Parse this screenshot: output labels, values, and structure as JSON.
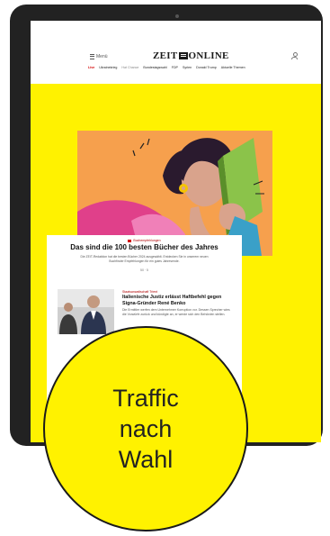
{
  "header": {
    "menu_label": "Menü",
    "logo_left": "ZEIT",
    "logo_right": "ONLINE"
  },
  "nav": {
    "items": [
      {
        "label": "Live",
        "style": "live"
      },
      {
        "label": "Ukrainekrieg",
        "style": "normal"
      },
      {
        "label": "Hat Chance",
        "style": "muted"
      },
      {
        "label": "Bundestagswahl",
        "style": "normal"
      },
      {
        "label": "FDP",
        "style": "normal"
      },
      {
        "label": "Syrien",
        "style": "normal"
      },
      {
        "label": "Donald Trump",
        "style": "normal"
      },
      {
        "label": "Aktuelle Themen",
        "style": "normal"
      }
    ]
  },
  "article": {
    "kicker": "Buchempfehlungen",
    "headline": "Das sind die 100 besten Bücher des Jahres",
    "teaser": "Die ZEIT-Redaktion hat die besten Bücher 2024 ausgewählt. Entdecken Sie in unserem neuen Buchfinder Empfehlungen für ein gutes Jahresende.",
    "meta": "50 · 5"
  },
  "secondary": {
    "kicker": "Staatsanwaltschaft Trient",
    "headline": "Italienische Justiz erlässt Haftbefehl gegen Signa-Gründer René Benko",
    "teaser": "Die Ermittler werfen dem Unternehmer Korruption vor. Dessen Sprecher wies die Vorwürfe zurück und kündigte an, er werde sich den Behörden stellen."
  },
  "overlay": {
    "text_lines": [
      "Traffic",
      "nach",
      "Wahl"
    ]
  },
  "colors": {
    "accent_yellow": "#FFF200",
    "hero_orange": "#F6A04D",
    "tablet_frame": "#222222",
    "live_red": "#d40000"
  }
}
